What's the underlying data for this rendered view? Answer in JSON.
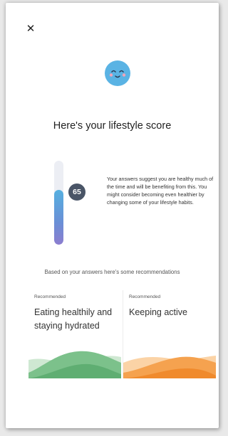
{
  "header": {
    "close_label": "✕"
  },
  "title": "Here's your lifestyle score",
  "score": {
    "value": "65",
    "fraction": 0.65
  },
  "summary_text": "Your answers suggest you are healthy much of the time and will be benefiting from this. You might consider becoming even healthier by changing some of your lifestyle habits.",
  "recommendations_intro": "Based on your answers here's some recommendations",
  "cards": [
    {
      "tag": "Recommended",
      "title": "Eating healthily and staying hydrated",
      "color": "#5fae72"
    },
    {
      "tag": "Recommended",
      "title": "Keeping active",
      "color": "#f08a2c"
    }
  ],
  "colors": {
    "face": "#5ab3e4",
    "badge": "#4a5567",
    "meter_top": "#56b0e0",
    "meter_bottom": "#8c7dcf"
  }
}
